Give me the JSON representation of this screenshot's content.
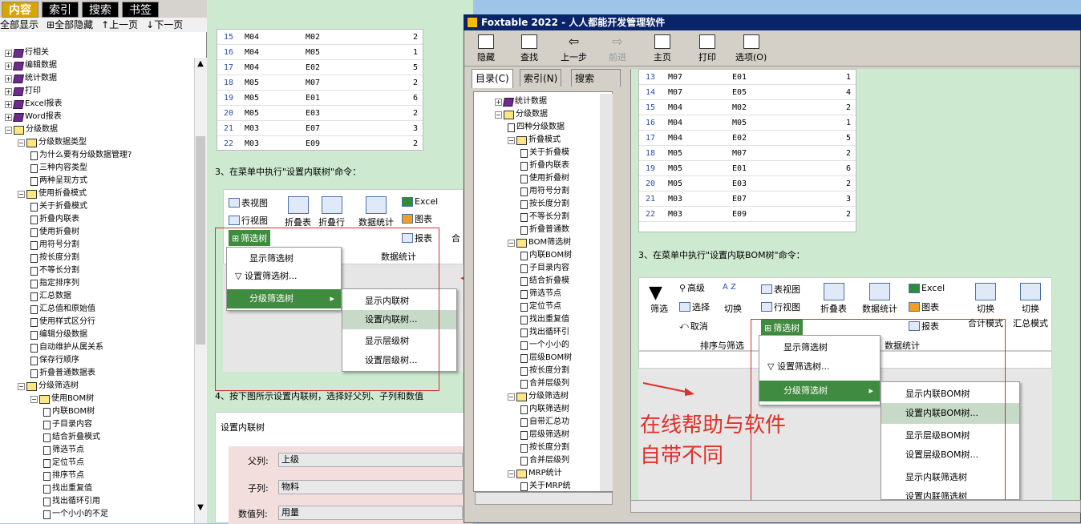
{
  "help": {
    "tabs": [
      "内容",
      "索引",
      "搜索",
      "书签"
    ],
    "toolbar": [
      "全部显示",
      "全部隐藏",
      "上一页",
      "下一页"
    ],
    "tree": [
      {
        "label": "行相关",
        "type": "book",
        "level": 0
      },
      {
        "label": "编辑数据",
        "type": "book",
        "level": 0
      },
      {
        "label": "统计数据",
        "type": "book",
        "level": 0
      },
      {
        "label": "打印",
        "type": "book",
        "level": 0
      },
      {
        "label": "Excel报表",
        "type": "book",
        "level": 0
      },
      {
        "label": "Word报表",
        "type": "book",
        "level": 0
      },
      {
        "label": "分级数据",
        "type": "open",
        "level": 0
      },
      {
        "label": "分级数据类型",
        "type": "open",
        "level": 1
      },
      {
        "label": "为什么要有分级数据管理?",
        "type": "page",
        "level": 2
      },
      {
        "label": "三种内容类型",
        "type": "page",
        "level": 2
      },
      {
        "label": "两种呈现方式",
        "type": "page",
        "level": 2
      },
      {
        "label": "使用折叠模式",
        "type": "open",
        "level": 1
      },
      {
        "label": "关于折叠模式",
        "type": "page",
        "level": 2
      },
      {
        "label": "折叠内联表",
        "type": "page",
        "level": 2
      },
      {
        "label": "使用折叠树",
        "type": "page",
        "level": 2
      },
      {
        "label": "用符号分割",
        "type": "page",
        "level": 2
      },
      {
        "label": "按长度分割",
        "type": "page",
        "level": 2
      },
      {
        "label": "不等长分割",
        "type": "page",
        "level": 2
      },
      {
        "label": "指定排序列",
        "type": "page",
        "level": 2
      },
      {
        "label": "汇总数据",
        "type": "page",
        "level": 2
      },
      {
        "label": "汇总值和原始值",
        "type": "page",
        "level": 2
      },
      {
        "label": "使用样式区分行",
        "type": "page",
        "level": 2
      },
      {
        "label": "编辑分级数据",
        "type": "page",
        "level": 2
      },
      {
        "label": "自动维护从属关系",
        "type": "page",
        "level": 2
      },
      {
        "label": "保存行顺序",
        "type": "page",
        "level": 2
      },
      {
        "label": "折叠普通数据表",
        "type": "page",
        "level": 2
      },
      {
        "label": "分级筛选树",
        "type": "open",
        "level": 1
      },
      {
        "label": "使用BOM树",
        "type": "open",
        "level": 2
      },
      {
        "label": "内联BOM树",
        "type": "page",
        "level": 3
      },
      {
        "label": "子目录内容",
        "type": "page",
        "level": 3
      },
      {
        "label": "结合折叠模式",
        "type": "page",
        "level": 3
      },
      {
        "label": "筛选节点",
        "type": "page",
        "level": 3
      },
      {
        "label": "定位节点",
        "type": "page",
        "level": 3
      },
      {
        "label": "排序节点",
        "type": "page",
        "level": 3
      },
      {
        "label": "找出重复值",
        "type": "page",
        "level": 3
      },
      {
        "label": "找出循环引用",
        "type": "page",
        "level": 3
      },
      {
        "label": "一个小小的不足",
        "type": "page",
        "level": 3
      }
    ]
  },
  "mid": {
    "table_rows": [
      [
        "15",
        "M04",
        "M02",
        "2"
      ],
      [
        "16",
        "M04",
        "M05",
        "1"
      ],
      [
        "17",
        "M04",
        "E02",
        "5"
      ],
      [
        "18",
        "M05",
        "M07",
        "2"
      ],
      [
        "19",
        "M05",
        "E01",
        "6"
      ],
      [
        "20",
        "M05",
        "E03",
        "2"
      ],
      [
        "21",
        "M03",
        "E07",
        "3"
      ],
      [
        "22",
        "M03",
        "E09",
        "2"
      ]
    ],
    "step3": "3、在菜单中执行\"设置内联树\"命令：",
    "ribbon": {
      "table_view": "表视图",
      "row_view": "行视图",
      "fold_table": "折叠表",
      "fold_row": "折叠行",
      "data_stats": "数据统计",
      "excel": "Excel",
      "chart": "图表",
      "report": "报表",
      "filter_tree": "筛选树",
      "group_label": "数据统计",
      "combine": "合"
    },
    "menu1": [
      "显示筛选树",
      "设置筛选树...",
      "分级筛选树"
    ],
    "menu2": [
      "显示内联树",
      "设置内联树...",
      "显示层级树",
      "设置层级树..."
    ],
    "step4": "4、按下图所示设置内联树，选择好父列、子列和数值",
    "dialog": {
      "title": "设置内联树",
      "parent_label": "父列:",
      "parent_value": "上级",
      "child_label": "子列:",
      "child_value": "物料",
      "value_label": "数值列:",
      "value_value": "用量"
    }
  },
  "fox": {
    "title": "Foxtable 2022 - 人人都能开发管理软件",
    "toolbar": [
      "隐藏",
      "查找",
      "上一步",
      "前进",
      "主页",
      "打印",
      "选项(O)"
    ],
    "tabs": [
      "目录(C)",
      "索引(N)",
      "搜索"
    ],
    "tree": [
      {
        "label": "统计数据",
        "type": "book",
        "level": 0
      },
      {
        "label": "分级数据",
        "type": "open",
        "level": 0
      },
      {
        "label": "四种分级数据",
        "type": "page",
        "level": 1
      },
      {
        "label": "折叠模式",
        "type": "open",
        "level": 1
      },
      {
        "label": "关于折叠模",
        "type": "page",
        "level": 2
      },
      {
        "label": "折叠内联表",
        "type": "page",
        "level": 2
      },
      {
        "label": "使用折叠树",
        "type": "page",
        "level": 2
      },
      {
        "label": "用符号分割",
        "type": "page",
        "level": 2
      },
      {
        "label": "按长度分割",
        "type": "page",
        "level": 2
      },
      {
        "label": "不等长分割",
        "type": "page",
        "level": 2
      },
      {
        "label": "折叠普通数",
        "type": "page",
        "level": 2
      },
      {
        "label": "BOM筛选树",
        "type": "open",
        "level": 1
      },
      {
        "label": "内联BOM树",
        "type": "page",
        "level": 2
      },
      {
        "label": "子目录内容",
        "type": "page",
        "level": 2
      },
      {
        "label": "结合折叠模",
        "type": "page",
        "level": 2
      },
      {
        "label": "筛选节点",
        "type": "page",
        "level": 2
      },
      {
        "label": "定位节点",
        "type": "page",
        "level": 2
      },
      {
        "label": "找出重复值",
        "type": "page",
        "level": 2
      },
      {
        "label": "找出循环引",
        "type": "page",
        "level": 2
      },
      {
        "label": "一个小小的",
        "type": "page",
        "level": 2
      },
      {
        "label": "层级BOM树",
        "type": "page",
        "level": 2
      },
      {
        "label": "按长度分割",
        "type": "page",
        "level": 2
      },
      {
        "label": "合并层级列",
        "type": "page",
        "level": 2
      },
      {
        "label": "分级筛选树",
        "type": "open",
        "level": 1
      },
      {
        "label": "内联筛选树",
        "type": "page",
        "level": 2
      },
      {
        "label": "自带汇总功",
        "type": "page",
        "level": 2
      },
      {
        "label": "层级筛选树",
        "type": "page",
        "level": 2
      },
      {
        "label": "按长度分割",
        "type": "page",
        "level": 2
      },
      {
        "label": "合并层级列",
        "type": "page",
        "level": 2
      },
      {
        "label": "MRP统计",
        "type": "open",
        "level": 1
      },
      {
        "label": "关于MRP统",
        "type": "page",
        "level": 2
      }
    ],
    "table_rows": [
      [
        "13",
        "M07",
        "E01",
        "1"
      ],
      [
        "14",
        "M07",
        "E05",
        "4"
      ],
      [
        "15",
        "M04",
        "M02",
        "2"
      ],
      [
        "16",
        "M04",
        "M05",
        "1"
      ],
      [
        "17",
        "M04",
        "E02",
        "5"
      ],
      [
        "18",
        "M05",
        "M07",
        "2"
      ],
      [
        "19",
        "M05",
        "E01",
        "6"
      ],
      [
        "20",
        "M05",
        "E03",
        "2"
      ],
      [
        "21",
        "M03",
        "E07",
        "3"
      ],
      [
        "22",
        "M03",
        "E09",
        "2"
      ]
    ],
    "step3": "3、在菜单中执行\"设置内联BOM树\"命令：",
    "ribbon": {
      "filter": "筛选",
      "advanced": "高级",
      "select": "选择",
      "cancel": "取消",
      "switch": "切换",
      "table_view": "表视图",
      "row_view": "行视图",
      "fold_table": "折叠表",
      "data_stats": "数据统计",
      "excel": "Excel",
      "chart": "图表",
      "report": "报表",
      "switch2": "切换",
      "total_mode": "合计模式",
      "switch3": "切换",
      "summary_mode": "汇总模式",
      "group_sort": "排序与筛选",
      "group_stats": "数据统计",
      "filter_tree": "筛选树"
    },
    "menu1": [
      "显示筛选树",
      "设置筛选树...",
      "分级筛选树"
    ],
    "menu2": [
      "显示内联BOM树",
      "设置内联BOM树...",
      "显示层级BOM树",
      "设置层级BOM树...",
      "显示内联筛选树",
      "设置内联筛选树"
    ],
    "annotation_line1": "在线帮助与软件",
    "annotation_line2": "自带不同"
  },
  "colors": {
    "accent": "#3f8b3f",
    "annotation": "#e0302a",
    "content_bg": "#cde9cf",
    "title_bar": "#0a246a"
  }
}
